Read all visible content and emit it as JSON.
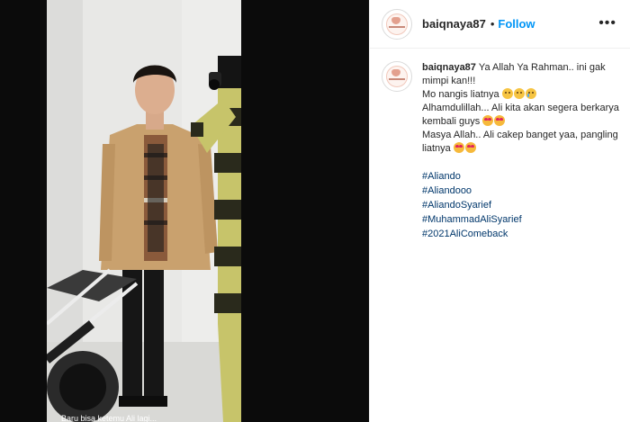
{
  "post": {
    "username": "baiqnaya87",
    "follow_label": "Follow",
    "separator": "•",
    "more_label": "•••"
  },
  "caption": {
    "username": "baiqnaya87",
    "line1": "Ya Allah Ya Rahman.. ini gak mimpi kan!!!",
    "line2": "Mo nangis liatnya",
    "line3": "Alhamdulillah... Ali kita akan segera berkarya kembali guys",
    "line4": "Masya Allah.. Ali cakep banget yaa, pangling liatnya",
    "hashtags": [
      "#Aliando",
      "#Aliandooo",
      "#AliandoSyarief",
      "#MuhammadAliSyarief",
      "#2021AliComeback"
    ]
  },
  "media": {
    "bottom_text": "Baru bisa ketemu Ali lagi..."
  },
  "colors": {
    "link_blue": "#0095f6",
    "hashtag_blue": "#00376b",
    "jacket": "#c9a16e",
    "stripe_yellow": "#c7c46a",
    "stripe_dark": "#2a2a1c"
  },
  "icons": [
    "avatar-logo",
    "more-options-icon",
    "sad-emoji",
    "crying-emoji",
    "heart-eyes-emoji"
  ]
}
